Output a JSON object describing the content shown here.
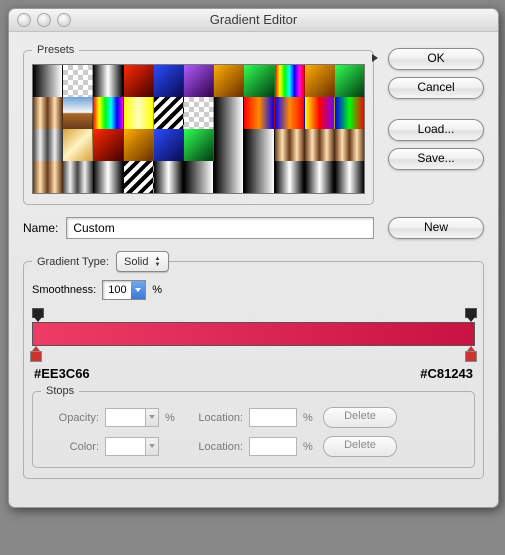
{
  "window": {
    "title": "Gradient Editor"
  },
  "buttons": {
    "ok": "OK",
    "cancel": "Cancel",
    "load": "Load...",
    "save": "Save...",
    "new": "New",
    "delete": "Delete"
  },
  "presets": {
    "legend": "Presets"
  },
  "name": {
    "label": "Name:",
    "value": "Custom"
  },
  "gradient_type": {
    "label": "Gradient Type:",
    "value": "Solid"
  },
  "smoothness": {
    "label": "Smoothness:",
    "value": "100",
    "unit": "%"
  },
  "gradient": {
    "left_color": "#EE3C66",
    "right_color": "#C81243"
  },
  "stops": {
    "legend": "Stops",
    "opacity_label": "Opacity:",
    "color_label": "Color:",
    "location_label": "Location:",
    "unit": "%",
    "opacity_value": "",
    "opacity_location": "",
    "color_value": "",
    "color_location": ""
  },
  "chart_data": {
    "type": "gradient",
    "color_stops": [
      {
        "location_pct": 0,
        "color": "#EE3C66"
      },
      {
        "location_pct": 100,
        "color": "#C81243"
      }
    ],
    "opacity_stops": [
      {
        "location_pct": 0,
        "opacity_pct": 100
      },
      {
        "location_pct": 100,
        "opacity_pct": 100
      }
    ],
    "smoothness_pct": 100
  }
}
